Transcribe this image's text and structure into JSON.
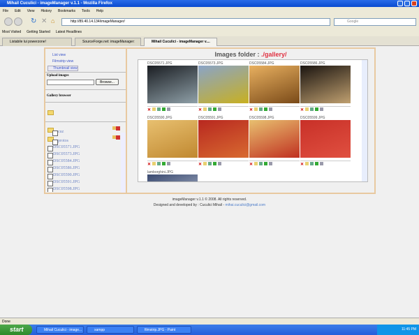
{
  "window": {
    "title": "Mihail Cuculici - imageManager v.1.1 - Mozilla Firefox"
  },
  "menu": [
    "File",
    "Edit",
    "View",
    "History",
    "Bookmarks",
    "Tools",
    "Help"
  ],
  "nav": {
    "url": "http://89.40.14.134/imageManager/",
    "search_placeholder": "Google"
  },
  "bookmarks": [
    "Most Visited",
    "Getting Started",
    "Latest Headlines"
  ],
  "tabs": [
    {
      "label": "Listabile lui powerzone!"
    },
    {
      "label": "SourceForge.net: imageManager: cucl..."
    },
    {
      "label": "Mihail Cuculici - imageManager v...."
    }
  ],
  "sidebar": {
    "views": [
      "List view",
      "Filmstrip view",
      "Thumbnail view"
    ],
    "upload_label": "Upload images",
    "browse_label": "Browse...",
    "gallery_browser": "Gallery browser",
    "folders": [
      "cuz",
      "protos"
    ],
    "files": [
      "DSC05571.JPG",
      "DSC05573.JPG",
      "DSC05584.JPG",
      "DSC05586.JPG",
      "DSC05590.JPG",
      "DSC05591.JPG",
      "DSC05598.JPG"
    ]
  },
  "main": {
    "heading": "Images folder : ",
    "path": "./gallery/",
    "thumbnails": [
      {
        "name": "DSC05571.JPG",
        "colors": [
          "#1a1d22",
          "#8fa0a8"
        ]
      },
      {
        "name": "DSC05573.JPG",
        "colors": [
          "#8aa4c8",
          "#c8b020"
        ]
      },
      {
        "name": "DSC05584.JPG",
        "colors": [
          "#e8b060",
          "#7a4a18"
        ]
      },
      {
        "name": "DSC05586.JPG",
        "colors": [
          "#1a1410",
          "#c0a070"
        ]
      },
      {
        "name": "DSC05590.JPG",
        "colors": [
          "#e8c070",
          "#c08830"
        ]
      },
      {
        "name": "DSC05591.JPG",
        "colors": [
          "#b82820",
          "#d86a30"
        ]
      },
      {
        "name": "DSC05598.JPG",
        "colors": [
          "#e8c070",
          "#c03020"
        ]
      },
      {
        "name": "DSC05599.JPG",
        "colors": [
          "#c83028",
          "#e05040"
        ]
      },
      {
        "name": "lamborghini.JPG",
        "colors": [
          "#3a4a70",
          "#c8d0e0"
        ]
      }
    ]
  },
  "footer": {
    "line1": "imageManager v.1.1 © 2008. All rights reserved.",
    "line2": "Designed and developed by : Cuculici Mihail - ",
    "email": "mihai.cuculici@gmail.com"
  },
  "status": "Done",
  "taskbar": {
    "start": "start",
    "tasks": [
      "Mihail Cuculici - image...",
      "xampp",
      "filmstrip.JPG - Paint"
    ],
    "clock": "11:45 PM"
  }
}
